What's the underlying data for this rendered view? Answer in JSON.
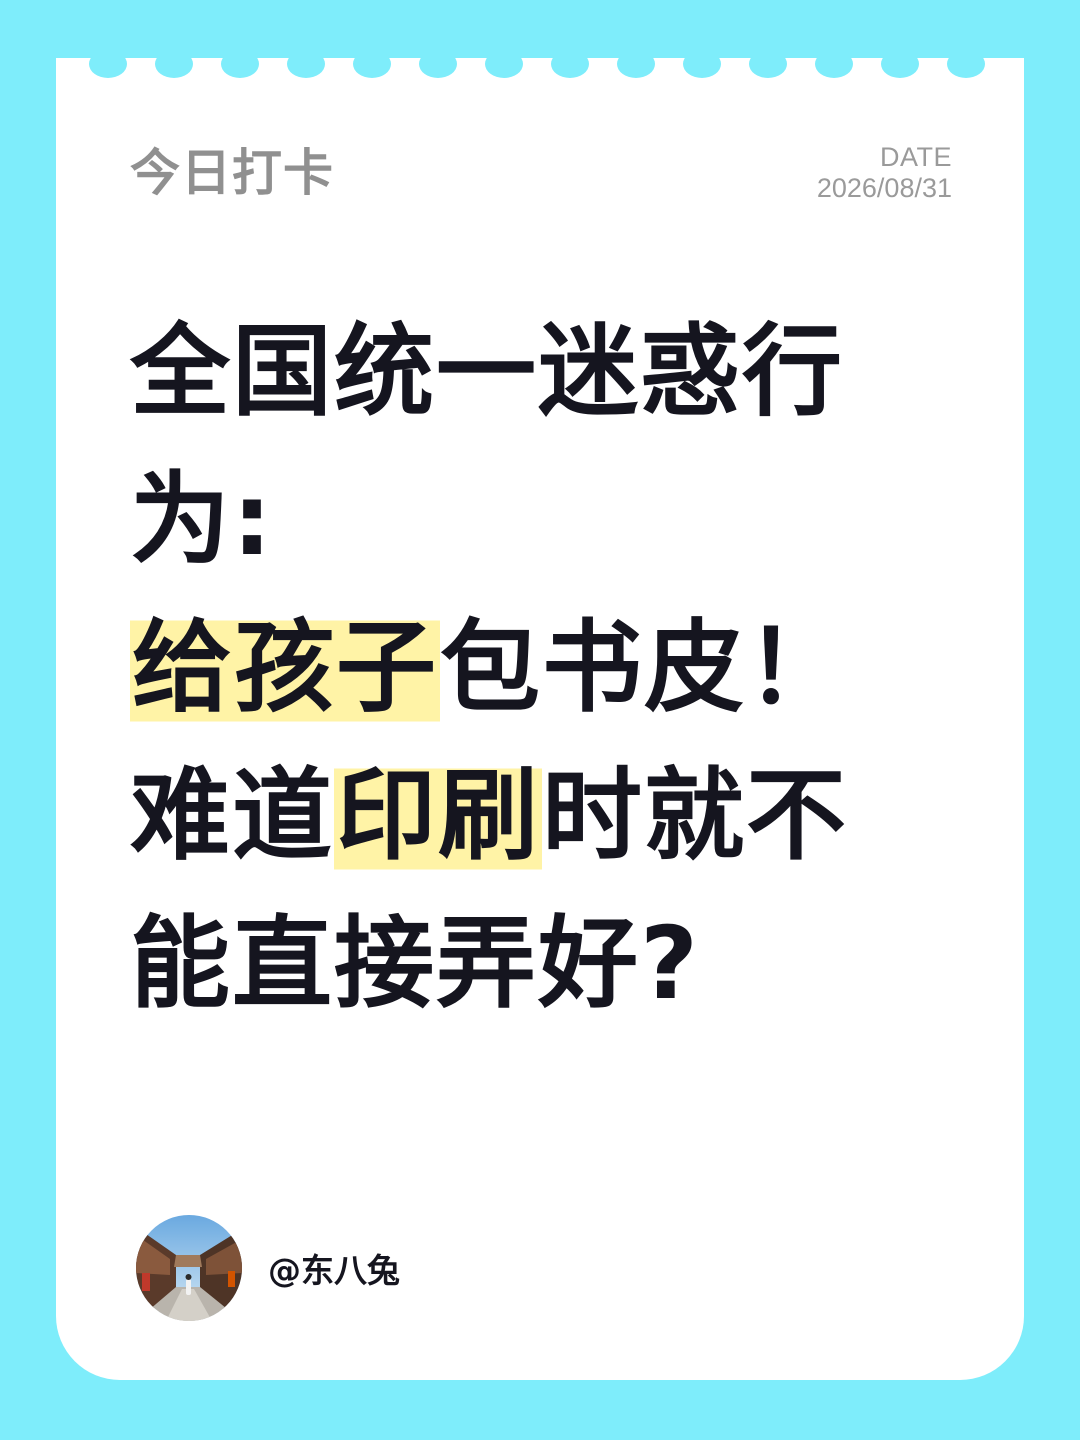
{
  "header": {
    "title": "今日打卡",
    "date_label": "DATE",
    "date_value": "2026/08/31"
  },
  "headline": {
    "line1": "全国统一迷惑行",
    "line2": "为:",
    "line3_highlight": "给孩子",
    "line3_rest": "包书皮！",
    "line4_start": "难道",
    "line4_highlight": "印刷",
    "line4_end": "时就不",
    "line5": "能直接弄好?"
  },
  "author": {
    "handle": "@东八兔",
    "avatar_icon": "avatar-photo-street"
  },
  "colors": {
    "background": "#7eedfb",
    "card": "#ffffff",
    "highlight": "#fff3a6",
    "text": "#15151f",
    "muted": "#909090"
  }
}
